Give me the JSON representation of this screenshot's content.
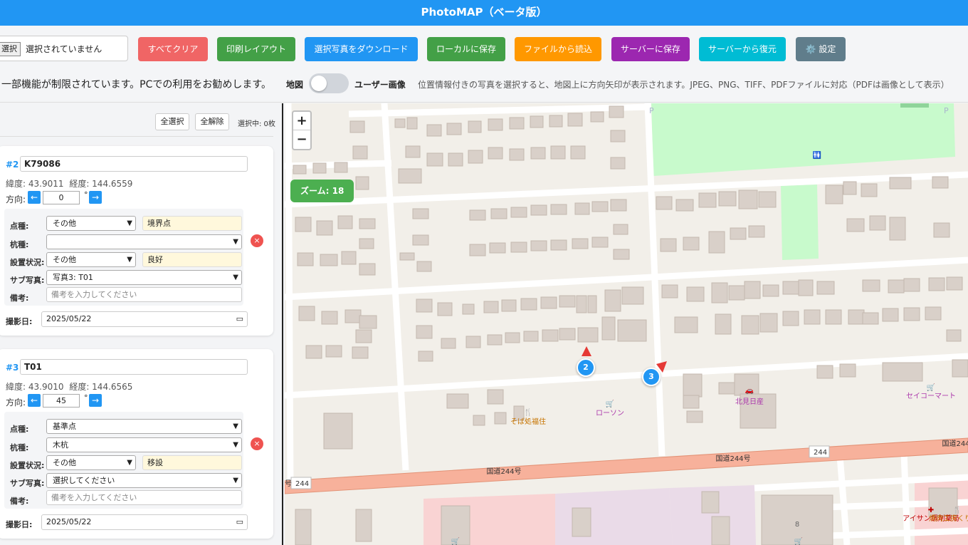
{
  "app": {
    "title": "PhotoMAP（ベータ版）"
  },
  "toolbar": {
    "file_button": "選択",
    "file_status": "選択されていません",
    "buttons": [
      {
        "label": "すべてクリア",
        "color": "#f06565"
      },
      {
        "label": "印刷レイアウト",
        "color": "#43a047"
      },
      {
        "label": "選択写真をダウンロード",
        "color": "#2196f3"
      },
      {
        "label": "ローカルに保存",
        "color": "#43a047"
      },
      {
        "label": "ファイルから読込",
        "color": "#ff9800"
      },
      {
        "label": "サーバーに保存",
        "color": "#9c27b0"
      },
      {
        "label": "サーバーから復元",
        "color": "#00bcd4"
      },
      {
        "label": "⚙️ 設定",
        "color": "#607d8b"
      }
    ],
    "notice": "一部機能が制限されています。PCでの利用をお勧めします。",
    "toggle_left_label": "地図",
    "toggle_right_label": "ユーザー画像",
    "toggle_on": false,
    "hint": "位置情報付きの写真を選択すると、地図上に方向矢印が表示されます。JPEG、PNG、TIFF、PDFファイルに対応（PDFは画像として表示）"
  },
  "panel": {
    "select_all": "全選択",
    "deselect_all": "全解除",
    "selected_count": "選択中: 0枚",
    "cards": [
      {
        "num": "#2",
        "id": "K79086",
        "lat": "緯度: 43.9011",
        "lon": "経度: 144.6559",
        "dir_label": "方向:",
        "dir_value": "0",
        "deg": "°",
        "point_type_label": "点種:",
        "point_type": "その他",
        "point_type_extra": "境界点",
        "stake_label": "杭種:",
        "stake": "",
        "status_label": "設置状況:",
        "status": "その他",
        "status_extra": "良好",
        "sub_label": "サブ写真:",
        "sub": "写真3: T01",
        "note_label": "備考:",
        "note_placeholder": "備考を入力してください",
        "date_label": "撮影日:",
        "date": "2025/05/22"
      },
      {
        "num": "#3",
        "id": "T01",
        "lat": "緯度: 43.9010",
        "lon": "経度: 144.6565",
        "dir_label": "方向:",
        "dir_value": "45",
        "deg": "°",
        "point_type_label": "点種:",
        "point_type": "基準点",
        "point_type_extra": "",
        "stake_label": "杭種:",
        "stake": "木杭",
        "status_label": "設置状況:",
        "status": "その他",
        "status_extra": "移設",
        "sub_label": "サブ写真:",
        "sub": "選択してください",
        "note_label": "備考:",
        "note_placeholder": "備考を入力してください",
        "date_label": "撮影日:",
        "date": "2025/05/22"
      }
    ]
  },
  "map": {
    "zoom_in": "+",
    "zoom_out": "−",
    "zoom_badge": "ズーム: 18",
    "markers": [
      "2",
      "3"
    ],
    "labels": {
      "route1": "国道244号",
      "route2": "国道244号",
      "route3": "国道244",
      "route_num1": "244",
      "route_num2": "244",
      "route_partial": "号",
      "soba": "そば処福住",
      "lawson": "ローソン",
      "kitami": "北見日産",
      "seicomart": "セイコーマート",
      "aisan": "アイサン調剤薬局",
      "yakiniku": "焼肉工房くりから",
      "num8": "8"
    },
    "colors": {
      "land": "#f2efe9",
      "building": "#d9d0c9",
      "park": "#c8facc",
      "primary_road": "#f7b19b",
      "commercial": "#f9d3d3",
      "retail": "#eadbe8"
    }
  }
}
